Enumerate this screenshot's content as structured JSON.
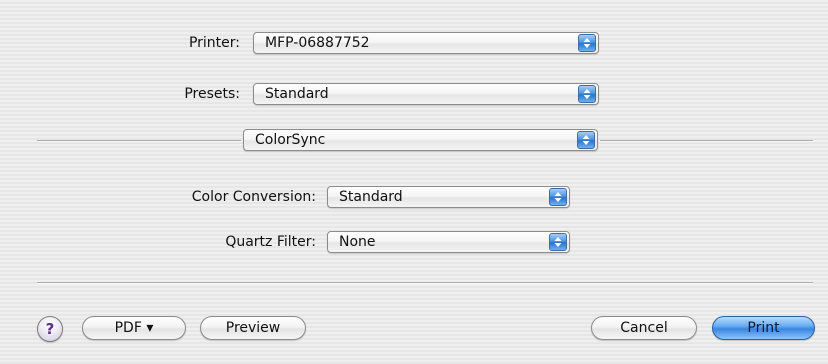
{
  "printer": {
    "label": "Printer:",
    "value": "MFP-06887752"
  },
  "presets": {
    "label": "Presets:",
    "value": "Standard"
  },
  "pane": {
    "value": "ColorSync"
  },
  "color_conversion": {
    "label": "Color Conversion:",
    "value": "Standard"
  },
  "quartz_filter": {
    "label": "Quartz Filter:",
    "value": "None"
  },
  "buttons": {
    "help": "?",
    "pdf": "PDF ▾",
    "preview": "Preview",
    "cancel": "Cancel",
    "print": "Print"
  },
  "colors": {
    "default_button": "#3b86e2",
    "popup_arrows": "#2a74d0",
    "help_glyph": "#5a2f8a"
  },
  "icons": {
    "popup_arrows": "updown-arrows-icon",
    "help": "help-icon",
    "pdf_menu": "triangle-down-icon"
  }
}
